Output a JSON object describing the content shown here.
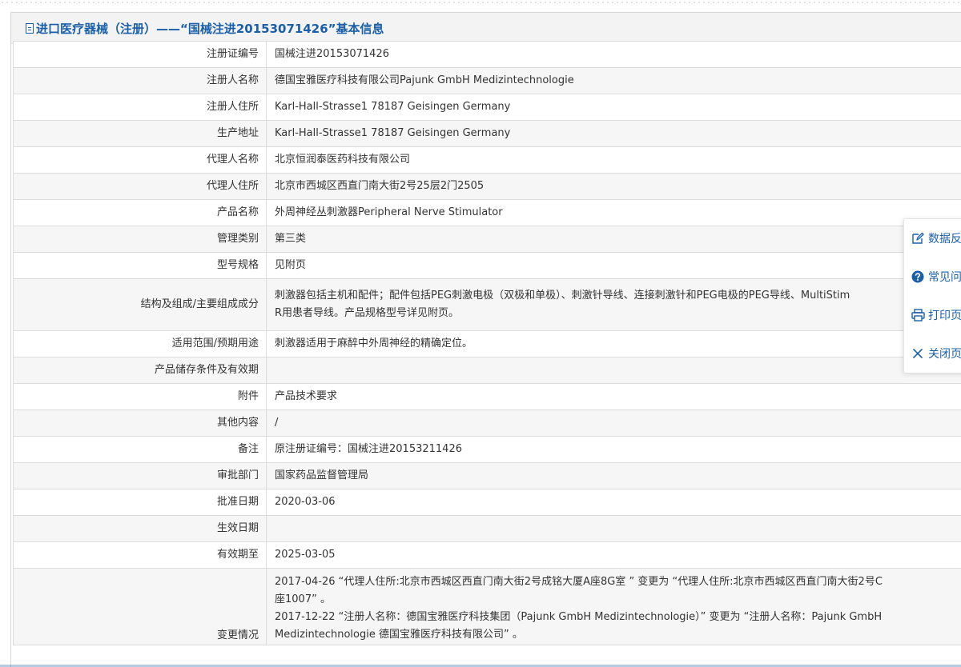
{
  "header": {
    "title": "进口医疗器械（注册）——“国械注进20153071426”基本信息"
  },
  "rows": [
    {
      "label": "注册证编号",
      "value": "国械注进20153071426"
    },
    {
      "label": "注册人名称",
      "value": "德国宝雅医疗科技有限公司Pajunk GmbH Medizintechnologie"
    },
    {
      "label": "注册人住所",
      "value": "Karl-Hall-Strasse1 78187 Geisingen Germany"
    },
    {
      "label": "生产地址",
      "value": "Karl-Hall-Strasse1 78187 Geisingen Germany"
    },
    {
      "label": "代理人名称",
      "value": "北京恒润泰医药科技有限公司"
    },
    {
      "label": "代理人住所",
      "value": "北京市西城区西直门南大街2号25层2门2505"
    },
    {
      "label": "产品名称",
      "value": "外周神经丛刺激器Peripheral Nerve Stimulator"
    },
    {
      "label": "管理类别",
      "value": "第三类"
    },
    {
      "label": "型号规格",
      "value": "见附页"
    },
    {
      "label": "结构及组成/主要组成成分",
      "value": "刺激器包括主机和配件；配件包括PEG刺激电极（双极和单极）、刺激针导线、连接刺激针和PEG电极的PEG导线、MultiStim\nR用患者导线。产品规格型号详见附页。"
    },
    {
      "label": "适用范围/预期用途",
      "value": "刺激器适用于麻醉中外周神经的精确定位。"
    },
    {
      "label": "产品储存条件及有效期",
      "value": ""
    },
    {
      "label": "附件",
      "value": "产品技术要求"
    },
    {
      "label": "其他内容",
      "value": "/"
    },
    {
      "label": "备注",
      "value": "原注册证编号：国械注进20153211426"
    },
    {
      "label": "审批部门",
      "value": "国家药品监督管理局"
    },
    {
      "label": "批准日期",
      "value": "2020-03-06"
    },
    {
      "label": "生效日期",
      "value": ""
    },
    {
      "label": "有效期至",
      "value": "2025-03-05"
    },
    {
      "label": "变更情况",
      "value": "2017-04-26 “代理人住所:北京市西城区西直门南大街2号成铭大厦A座8G室 ” 变更为 “代理人住所:北京市西城区西直门南大街2号C\n座1007” 。\n2017-12-22 “注册人名称：德国宝雅医疗科技集团（Pajunk GmbH Medizintechnologie）” 变更为 “注册人名称：Pajunk GmbH\nMedizintechnologie 德国宝雅医疗科技有限公司” 。"
    }
  ],
  "side_panel": {
    "items": [
      {
        "label": "数据反",
        "icon": "edit-icon"
      },
      {
        "label": "常见问",
        "icon": "help-icon"
      },
      {
        "label": "打印页",
        "icon": "print-icon"
      },
      {
        "label": "关闭页",
        "icon": "close-icon"
      }
    ]
  },
  "colors": {
    "accent": "#1a5fa8",
    "row_alt": "#f6f6f6",
    "border": "#dcdcdc"
  }
}
